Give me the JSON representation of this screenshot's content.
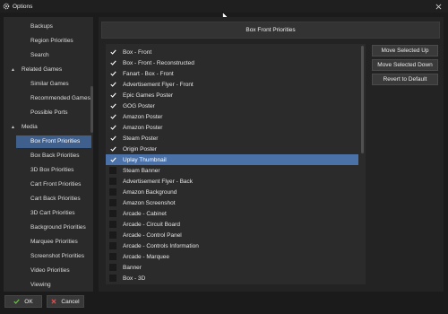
{
  "window": {
    "title": "Options"
  },
  "sidebar": {
    "items": [
      {
        "label": "Backups",
        "kind": "child"
      },
      {
        "label": "Region Priorities",
        "kind": "child"
      },
      {
        "label": "Search",
        "kind": "child"
      },
      {
        "label": "Related Games",
        "kind": "group"
      },
      {
        "label": "Similar Games",
        "kind": "child"
      },
      {
        "label": "Recommended Games",
        "kind": "child"
      },
      {
        "label": "Possible Ports",
        "kind": "child"
      },
      {
        "label": "Media",
        "kind": "group"
      },
      {
        "label": "Box Front Priorities",
        "kind": "child",
        "selected": true
      },
      {
        "label": "Box Back Priorities",
        "kind": "child"
      },
      {
        "label": "3D Box Priorities",
        "kind": "child"
      },
      {
        "label": "Cart Front Priorities",
        "kind": "child"
      },
      {
        "label": "Cart Back Priorities",
        "kind": "child"
      },
      {
        "label": "3D Cart Priorities",
        "kind": "child"
      },
      {
        "label": "Background Priorities",
        "kind": "child"
      },
      {
        "label": "Marquee Priorities",
        "kind": "child"
      },
      {
        "label": "Screenshot Priorities",
        "kind": "child"
      },
      {
        "label": "Video Priorities",
        "kind": "child"
      },
      {
        "label": "Viewing",
        "kind": "child"
      }
    ]
  },
  "main": {
    "header": "Box Front Priorities",
    "list": [
      {
        "label": "Box - Front",
        "checked": true
      },
      {
        "label": "Box - Front - Reconstructed",
        "checked": true
      },
      {
        "label": "Fanart - Box - Front",
        "checked": true
      },
      {
        "label": "Advertisement Flyer - Front",
        "checked": true
      },
      {
        "label": "Epic Games Poster",
        "checked": true
      },
      {
        "label": "GOG Poster",
        "checked": true
      },
      {
        "label": "Amazon Poster",
        "checked": true
      },
      {
        "label": "Amazon Poster",
        "checked": true
      },
      {
        "label": "Steam Poster",
        "checked": true
      },
      {
        "label": "Origin Poster",
        "checked": true
      },
      {
        "label": "Uplay Thumbnail",
        "checked": true,
        "selected": true
      },
      {
        "label": "Steam Banner",
        "checked": false
      },
      {
        "label": "Advertisement Flyer - Back",
        "checked": false
      },
      {
        "label": "Amazon Background",
        "checked": false
      },
      {
        "label": "Amazon Screenshot",
        "checked": false
      },
      {
        "label": "Arcade - Cabinet",
        "checked": false
      },
      {
        "label": "Arcade - Circuit Board",
        "checked": false
      },
      {
        "label": "Arcade - Control Panel",
        "checked": false
      },
      {
        "label": "Arcade - Controls Information",
        "checked": false
      },
      {
        "label": "Arcade - Marquee",
        "checked": false
      },
      {
        "label": "Banner",
        "checked": false
      },
      {
        "label": "Box - 3D",
        "checked": false
      }
    ],
    "buttons": {
      "move_up": "Move Selected Up",
      "move_down": "Move Selected Down",
      "revert": "Revert to Default"
    }
  },
  "footer": {
    "ok": "OK",
    "cancel": "Cancel"
  },
  "colors": {
    "accent_selected_tree": "#3f5f8c",
    "accent_selected_list": "#4a72a8",
    "ok_check": "#6cc04a",
    "cancel_x": "#e05050"
  },
  "icons": [
    "gear-icon",
    "close-icon",
    "cursor-icon",
    "caret-icon",
    "check-icon",
    "x-icon"
  ]
}
